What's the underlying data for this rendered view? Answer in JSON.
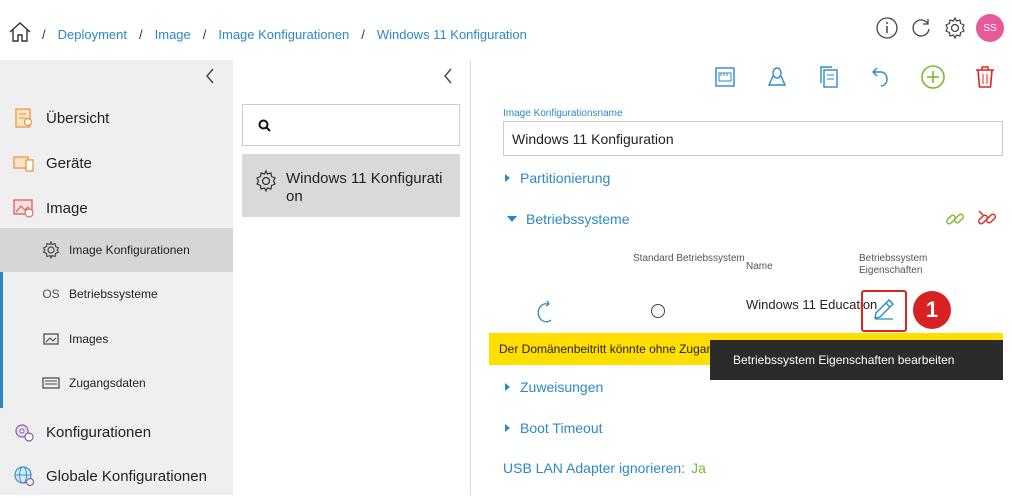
{
  "breadcrumb": {
    "items": [
      "Deployment",
      "Image",
      "Image Konfigurationen",
      "Windows 11 Konfiguration"
    ],
    "separator": "/"
  },
  "header": {
    "icons": [
      "info-icon",
      "refresh-icon",
      "settings-icon"
    ],
    "avatar": "SS"
  },
  "sidebar": {
    "items": [
      {
        "label": "Übersicht",
        "icon": "overview-icon"
      },
      {
        "label": "Geräte",
        "icon": "devices-icon"
      },
      {
        "label": "Image",
        "icon": "image-icon"
      },
      {
        "label": "Image Konfigurationen",
        "icon": "gear-icon",
        "sub": true,
        "active": true
      },
      {
        "label": "Betriebssysteme",
        "icon": "os-icon",
        "icon_text": "OS",
        "sub": true
      },
      {
        "label": "Images",
        "icon": "images-icon",
        "sub": true
      },
      {
        "label": "Zugangsdaten",
        "icon": "credentials-icon",
        "sub": true
      },
      {
        "label": "Konfigurationen",
        "icon": "configurations-icon"
      },
      {
        "label": "Globale Konfigurationen",
        "icon": "globe-icon"
      }
    ]
  },
  "middle": {
    "search": {
      "placeholder": "",
      "value": ""
    },
    "list": [
      {
        "label": "Windows 11 Konfiguration"
      }
    ]
  },
  "toolbar": {
    "icons": [
      "network-icon",
      "linux-icon",
      "copy-icon",
      "undo-icon",
      "add-icon",
      "delete-icon"
    ]
  },
  "form": {
    "name_label": "Image Konfigurationsname",
    "name_value": "Windows 11 Konfiguration",
    "sections": {
      "partitioning": "Partitionierung",
      "operating_systems": "Betriebssysteme",
      "assignments": "Zuweisungen",
      "boot_timeout": "Boot Timeout"
    },
    "os_table": {
      "col_standard": "Standard Betriebssystem",
      "col_name": "Name",
      "col_props": "Betriebssystem Eigenschaften",
      "row": {
        "name": "Windows 11 Education",
        "standard_selected": false
      }
    },
    "warning": "Der Domänenbeitritt könnte ohne Zugangsdaten nicht richtig funktionieren",
    "tooltip": "Betriebssystem Eigenschaften bearbeiten",
    "badge": "1",
    "usb_label": "USB LAN Adapter ignorieren:",
    "usb_value": "Ja"
  },
  "colors": {
    "accent": "#2b8ac6",
    "warning_bg": "#ffde00",
    "highlight": "#e02424",
    "avatar_bg": "#e55a9a",
    "green": "#7cb82f"
  }
}
